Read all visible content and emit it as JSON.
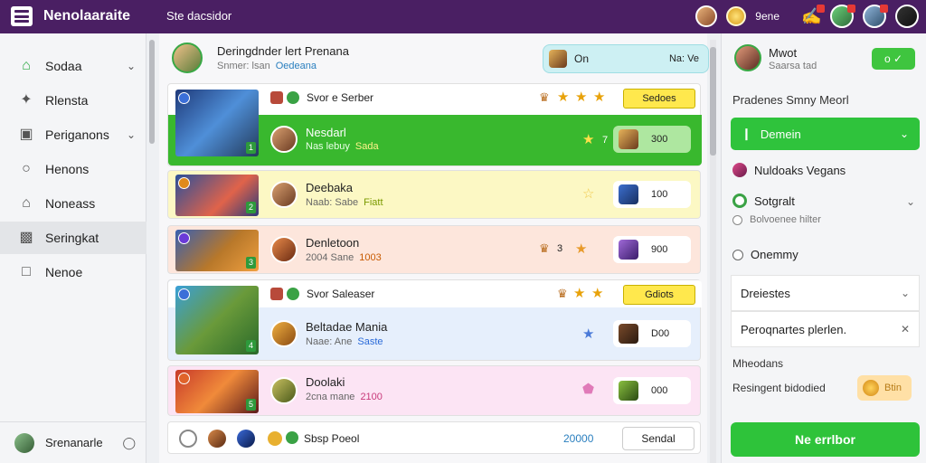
{
  "topbar": {
    "app_title": "Nenolaaraite",
    "search_placeholder": "Ste dacsidor",
    "coins": "9ene",
    "notification_icon": "chat-bubble-icon"
  },
  "sidebar": {
    "items": [
      {
        "label": "Sodaa",
        "icon": "home-icon",
        "has_chevron": true
      },
      {
        "label": "Rlensta",
        "icon": "star-icon",
        "has_chevron": false
      },
      {
        "label": "Periganons",
        "icon": "bag-icon",
        "has_chevron": true
      },
      {
        "label": "Henons",
        "icon": "clock-icon",
        "has_chevron": false
      },
      {
        "label": "Noneass",
        "icon": "house-icon",
        "has_chevron": false
      },
      {
        "label": "Seringkat",
        "icon": "store-icon",
        "has_chevron": false
      },
      {
        "label": "Nenoe",
        "icon": "doc-icon",
        "has_chevron": false
      }
    ],
    "active_index": 5,
    "footer_name": "Srenanarle"
  },
  "header": {
    "title": "Deringdnder lert Prenana",
    "sub_left": "Snmer: lsan",
    "sub_accent": "Oedeana",
    "pill_label": "On",
    "pill_value": "Na: Ve"
  },
  "rows": [
    {
      "subtitle": "Svor e Serber",
      "button": "Sedoes",
      "name": "Nesdarl",
      "meta": "Nas lebuy",
      "meta_accent": "Sada",
      "rank": "7",
      "score": "300",
      "bg": "#39b82e",
      "text": "#ffffff"
    },
    {
      "name": "Deebaka",
      "meta": "Naab: Sabe",
      "meta_accent": "Fiatt",
      "rank": "",
      "score": "100",
      "bg": "#fcf8c4",
      "text": "#222222"
    },
    {
      "name": "Denletoon",
      "meta": "2004 Sane",
      "meta_accent": "1003",
      "rank": "3",
      "score": "900",
      "bg": "#fde6dc",
      "text": "#222222"
    },
    {
      "subtitle": "Svor Saleaser",
      "button": "Gdiots",
      "name": "Beltadae Mania",
      "meta": "Naae: Ane",
      "meta_accent": "Saste",
      "rank": "",
      "score": "D00",
      "bg": "#e6effc",
      "text": "#222222"
    },
    {
      "name": "Doolaki",
      "meta": "2cna mane",
      "meta_accent": "2100",
      "rank": "",
      "score": "000",
      "bg": "#fce4f4",
      "text": "#222222"
    }
  ],
  "bottom_row": {
    "label": "Sbsp Poeol",
    "number": "20000",
    "button": "Sendal"
  },
  "right_panel": {
    "user_name": "Mwot",
    "user_sub": "Saarsa tad",
    "toggle_label": "o",
    "section_title": "Pradenes Smny Meorl",
    "green_dropdown": "Demein",
    "users_heading": "Nuldoaks Vegans",
    "option1": "Sotgralt",
    "option2": "Bolvoenee hilter",
    "option3": "Onemmy",
    "card1": "Dreiestes",
    "card2": "Peroqnartes plerlen.",
    "ach_heading": "Mheodans",
    "ach_label": "Resingent bidodied",
    "gold_value": "Btin",
    "cta": "Ne errlbor"
  }
}
